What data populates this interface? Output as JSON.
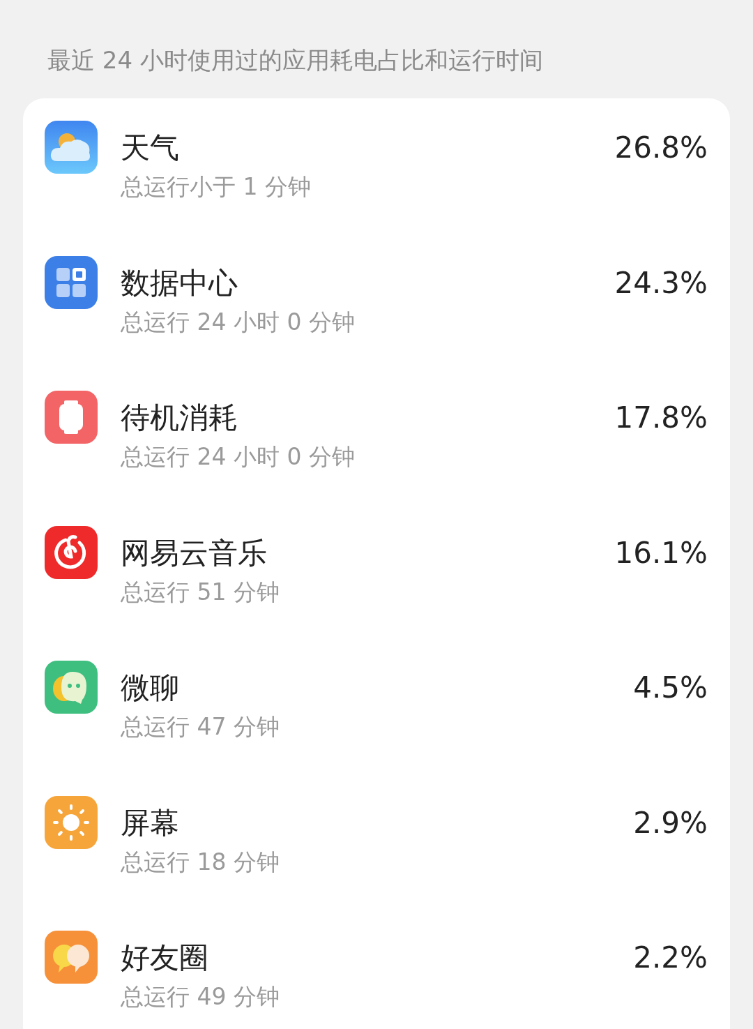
{
  "header": "最近 24 小时使用过的应用耗电占比和运行时间",
  "apps": [
    {
      "kind": "weather",
      "name": "天气",
      "runtime": "总运行小于 1 分钟",
      "percent": "26.8%"
    },
    {
      "kind": "grid",
      "name": "数据中心",
      "runtime": "总运行 24 小时 0 分钟",
      "percent": "24.3%"
    },
    {
      "kind": "watch",
      "name": "待机消耗",
      "runtime": "总运行 24 小时 0 分钟",
      "percent": "17.8%"
    },
    {
      "kind": "music",
      "name": "网易云音乐",
      "runtime": "总运行 51 分钟",
      "percent": "16.1%"
    },
    {
      "kind": "chat",
      "name": "微聊",
      "runtime": "总运行 47 分钟",
      "percent": "4.5%"
    },
    {
      "kind": "sun",
      "name": "屏幕",
      "runtime": "总运行 18 分钟",
      "percent": "2.9%"
    },
    {
      "kind": "bubbles",
      "name": "好友圈",
      "runtime": "总运行 49 分钟",
      "percent": "2.2%"
    }
  ]
}
